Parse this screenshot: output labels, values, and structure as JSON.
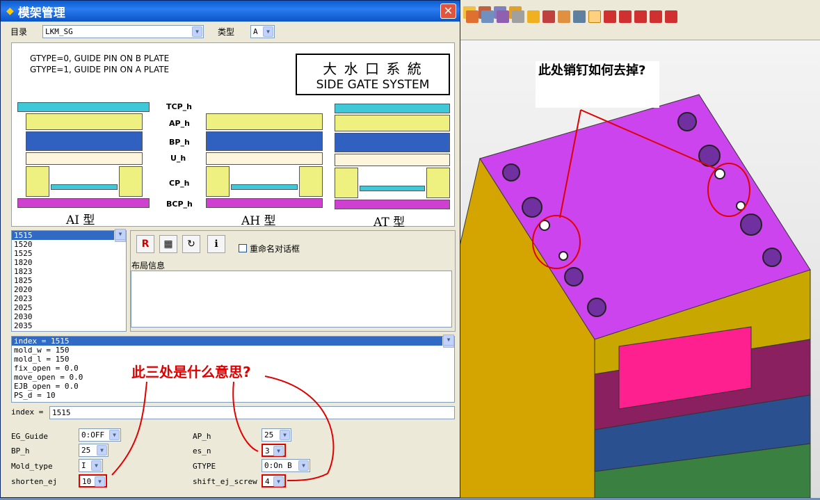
{
  "dialog": {
    "title": "模架管理",
    "close_label": "✕",
    "catalog_label": "目录",
    "catalog_value": "LKM_SG",
    "type_label": "类型",
    "type_value": "A"
  },
  "image": {
    "gtype0": "GTYPE=0, GUIDE PIN ON B PLATE",
    "gtype1": "GTYPE=1, GUIDE PIN ON A PLATE",
    "system_title_cn": "大 水 口 系 統",
    "system_title_en": "SIDE GATE SYSTEM",
    "labels": [
      "TCP_h",
      "AP_h",
      "BP_h",
      "U_h",
      "CP_h",
      "BCP_h"
    ],
    "types": [
      "AI 型",
      "AH 型",
      "AT 型"
    ]
  },
  "size_list": [
    "1515",
    "1520",
    "1525",
    "1820",
    "1823",
    "1825",
    "2020",
    "2023",
    "2025",
    "2030",
    "2035"
  ],
  "rename_checkbox_label": "重命名对话框",
  "layout_info_label": "布局信息",
  "params": [
    "index = 1515",
    "mold_w = 150",
    "mold_l = 150",
    "fix_open = 0.0",
    "move_open = 0.0",
    "EJB_open = 0.0",
    "PS_d = 10"
  ],
  "index_field": {
    "label": "index =",
    "value": "1515"
  },
  "fields": {
    "eg_guide": {
      "label": "EG_Guide",
      "value": "0:OFF"
    },
    "bp_h": {
      "label": "BP_h",
      "value": "25"
    },
    "mold_type": {
      "label": "Mold_type",
      "value": "I"
    },
    "shorten_ej": {
      "label": "shorten_ej",
      "value": "10"
    },
    "ap_h": {
      "label": "AP_h",
      "value": "25"
    },
    "es_n": {
      "label": "es_n",
      "value": "3"
    },
    "gtype": {
      "label": "GTYPE",
      "value": "0:On B"
    },
    "shift_ej_screw": {
      "label": "shift_ej_screw",
      "value": "4"
    }
  },
  "annotations": {
    "question1": "此三处是什么意思?",
    "question2": "此处销钉如何去掉?"
  },
  "colors": {
    "note": "#e00000",
    "title_bar": "#0a5ecf",
    "mold_top": "#cc44ee"
  }
}
